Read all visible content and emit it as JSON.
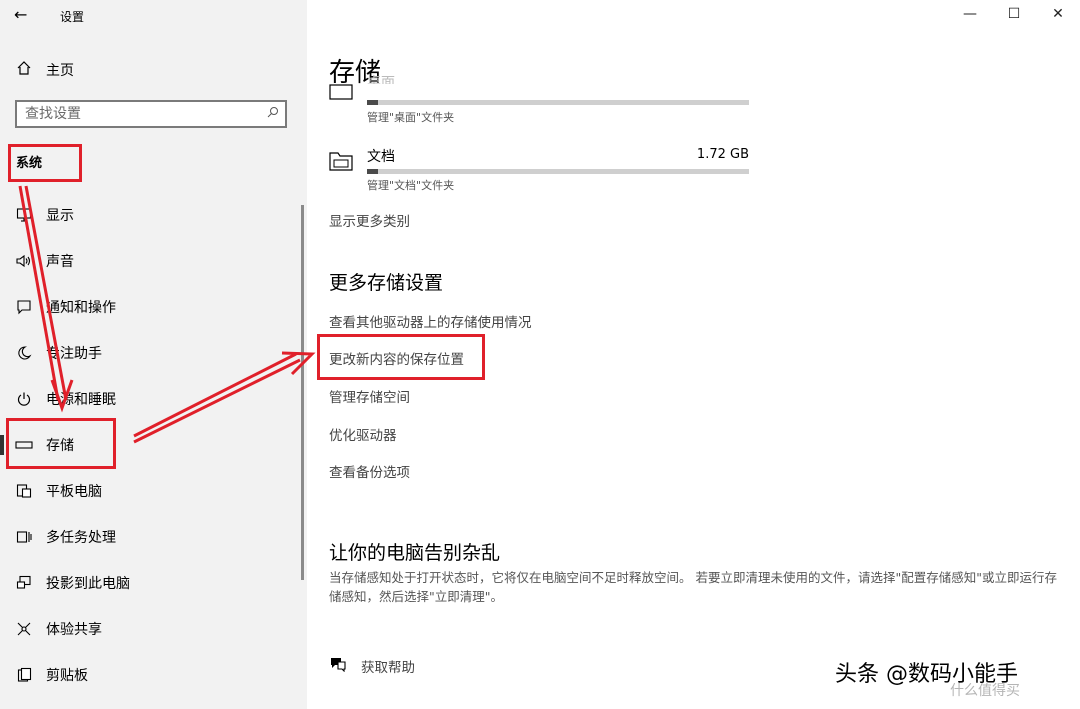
{
  "window": {
    "title": "设置",
    "back_icon": "arrow-left-icon",
    "controls": {
      "minimize": "—",
      "maximize": "☐",
      "close": "✕"
    }
  },
  "sidebar": {
    "home_label": "主页",
    "search_placeholder": "查找设置",
    "section_label": "系统",
    "items": [
      {
        "label": "显示",
        "icon": "monitor-icon"
      },
      {
        "label": "声音",
        "icon": "speaker-icon"
      },
      {
        "label": "通知和操作",
        "icon": "notification-icon"
      },
      {
        "label": "专注助手",
        "icon": "moon-icon"
      },
      {
        "label": "电源和睡眠",
        "icon": "power-icon"
      },
      {
        "label": "存储",
        "icon": "storage-icon",
        "selected": true
      },
      {
        "label": "平板电脑",
        "icon": "tablet-icon"
      },
      {
        "label": "多任务处理",
        "icon": "multitask-icon"
      },
      {
        "label": "投影到此电脑",
        "icon": "project-icon"
      },
      {
        "label": "体验共享",
        "icon": "share-icon"
      },
      {
        "label": "剪贴板",
        "icon": "clipboard-icon"
      }
    ]
  },
  "main": {
    "title": "存储",
    "categories": [
      {
        "name": "桌面",
        "size": "",
        "description": "管理\"桌面\"文件夹",
        "usage": 0.03
      },
      {
        "name": "文档",
        "size": "1.72 GB",
        "description": "管理\"文档\"文件夹",
        "usage": 0.03
      }
    ],
    "show_more": "显示更多类别",
    "more_settings": {
      "heading": "更多存储设置",
      "links": [
        "查看其他驱动器上的存储使用情况",
        "更改新内容的保存位置",
        "管理存储空间",
        "优化驱动器",
        "查看备份选项"
      ]
    },
    "declutter": {
      "heading": "让你的电脑告别杂乱",
      "text": "当存储感知处于打开状态时，它将仅在电脑空间不足时释放空间。 若要立即清理未使用的文件，请选择\"配置存储感知\"或立即运行存储感知，然后选择\"立即清理\"。"
    },
    "help_label": "获取帮助"
  },
  "watermark": {
    "text": "头条 @数码小能手",
    "sub": "什么值得买"
  },
  "colors": {
    "annotation": "#e0202a",
    "sidebar_bg": "#f2f2f2",
    "accent": "#333333"
  }
}
